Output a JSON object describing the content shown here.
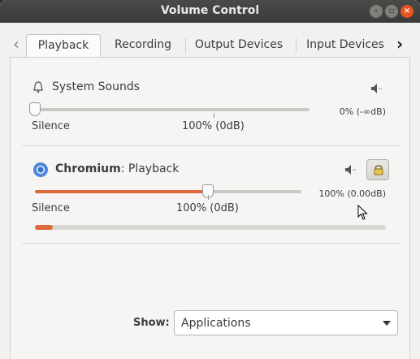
{
  "window": {
    "title": "Volume Control",
    "controls": [
      "minimize",
      "maximize",
      "close"
    ]
  },
  "tabs": {
    "items": [
      {
        "label": "Playback",
        "active": true
      },
      {
        "label": "Recording",
        "active": false
      },
      {
        "label": "Output Devices",
        "active": false
      },
      {
        "label": "Input Devices",
        "active": false
      }
    ],
    "scroll_left_icon": "chevron-left-icon",
    "scroll_right_icon": "chevron-right-icon"
  },
  "streams": [
    {
      "name": "System Sounds",
      "app_bold": "",
      "icon": "bell-icon",
      "volume_percent": 0,
      "volume_text": "0% (-∞dB)",
      "tick_labels": {
        "silence": "Silence",
        "normal": "100% (0dB)"
      },
      "muted_icon": "speaker-icon",
      "lock_button": false
    },
    {
      "name": ": Playback",
      "app_bold": "Chromium",
      "icon": "chromium-icon",
      "volume_percent": 100,
      "volume_text": "100% (0.00dB)",
      "tick_labels": {
        "silence": "Silence",
        "normal": "100% (0dB)"
      },
      "muted_icon": "speaker-icon",
      "lock_button": true,
      "lock_icon": "lock-icon",
      "level_fraction": 0.05
    }
  ],
  "footer": {
    "show_label": "Show:",
    "show_value": "Applications"
  },
  "colors": {
    "accent": "#e06a3c",
    "titlebar": "#3b3b39",
    "close_button": "#e95420"
  }
}
